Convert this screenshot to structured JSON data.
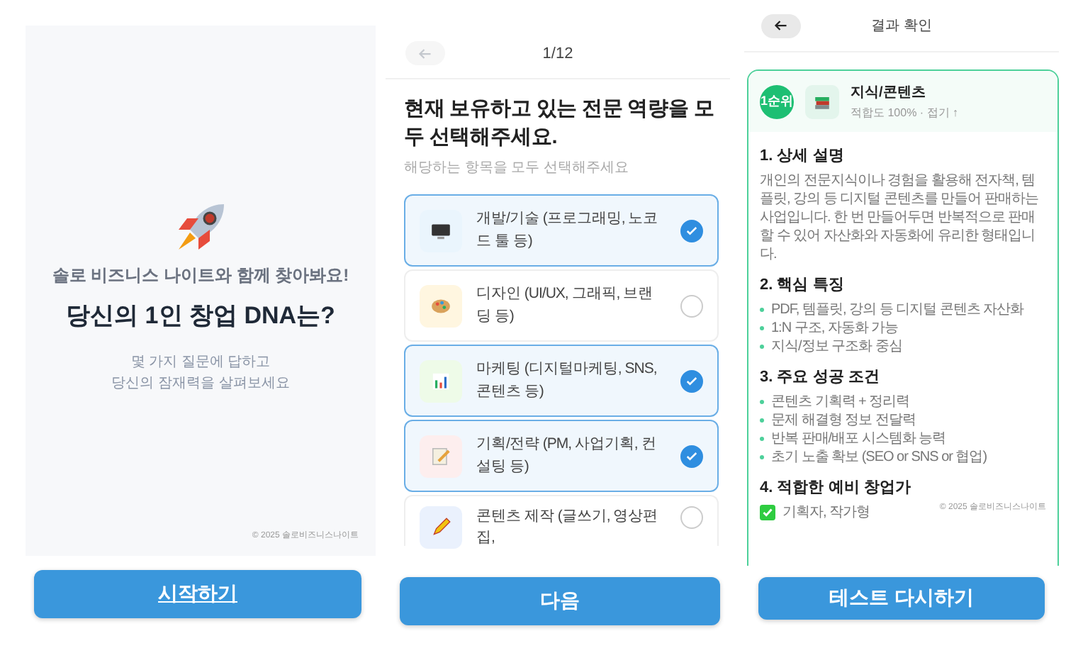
{
  "intro": {
    "subtitle": "솔로 비즈니스 나이트와 함께 찾아봐요!",
    "title": "당신의 1인 창업 DNA는?",
    "description_lines": [
      "몇 가지 질문에 답하고",
      "당신의 잠재력을 살펴보세요"
    ],
    "copyright": "© 2025 솔로비즈니스나이트",
    "button": "시작하기"
  },
  "question": {
    "progress": "1/12",
    "title": "현재 보유하고 있는 전문 역량을 모두 선택해주세요.",
    "hint": "해당하는 항목을 모두 선택해주세요",
    "options": [
      {
        "label": "개발/기술 (프로그래밍, 노코드 툴 등)",
        "selected": true,
        "kind": "monitor"
      },
      {
        "label": "디자인 (UI/UX, 그래픽, 브랜딩 등)",
        "selected": false,
        "kind": "palette"
      },
      {
        "label": "마케팅 (디지털마케팅, SNS, 콘텐츠 등)",
        "selected": true,
        "kind": "chart"
      },
      {
        "label": "기획/전략 (PM, 사업기획, 컨설팅 등)",
        "selected": true,
        "kind": "memo"
      },
      {
        "label": "콘텐츠 제작 (글쓰기, 영상편집,",
        "selected": false,
        "kind": "pencil"
      }
    ],
    "button": "다음"
  },
  "result": {
    "title": "결과 확인",
    "rank": "1순위",
    "type": "지식/콘텐츠",
    "meta": "적합도 100% · 접기 ↑",
    "sections": [
      {
        "heading": "1. 상세 설명",
        "kind": "paragraph",
        "text": "개인의 전문지식이나 경험을 활용해 전자책, 템플릿, 강의 등 디지털 콘텐츠를 만들어 판매하는 사업입니다. 한 번 만들어두면 반복적으로 판매할 수 있어 자산화와 자동화에 유리한 형태입니다."
      },
      {
        "heading": "2. 핵심 특징",
        "kind": "bullets",
        "items": [
          "PDF, 템플릿, 강의 등 디지털 콘텐츠 자산화",
          "1:N 구조, 자동화 가능",
          "지식/정보 구조화 중심"
        ]
      },
      {
        "heading": "3. 주요 성공 조건",
        "kind": "bullets",
        "items": [
          "콘텐츠 기획력 + 정리력",
          "문제 해결형 정보 전달력",
          "반복 판매/배포 시스템화 능력",
          "초기 노출 확보 (SEO or SNS or 협업)"
        ]
      },
      {
        "heading": "4. 적합한 예비 창업가",
        "kind": "checks",
        "items": [
          "기획자, 작가형"
        ]
      }
    ],
    "copyright": "© 2025 솔로비즈니스나이트",
    "button": "테스트 다시하기"
  }
}
